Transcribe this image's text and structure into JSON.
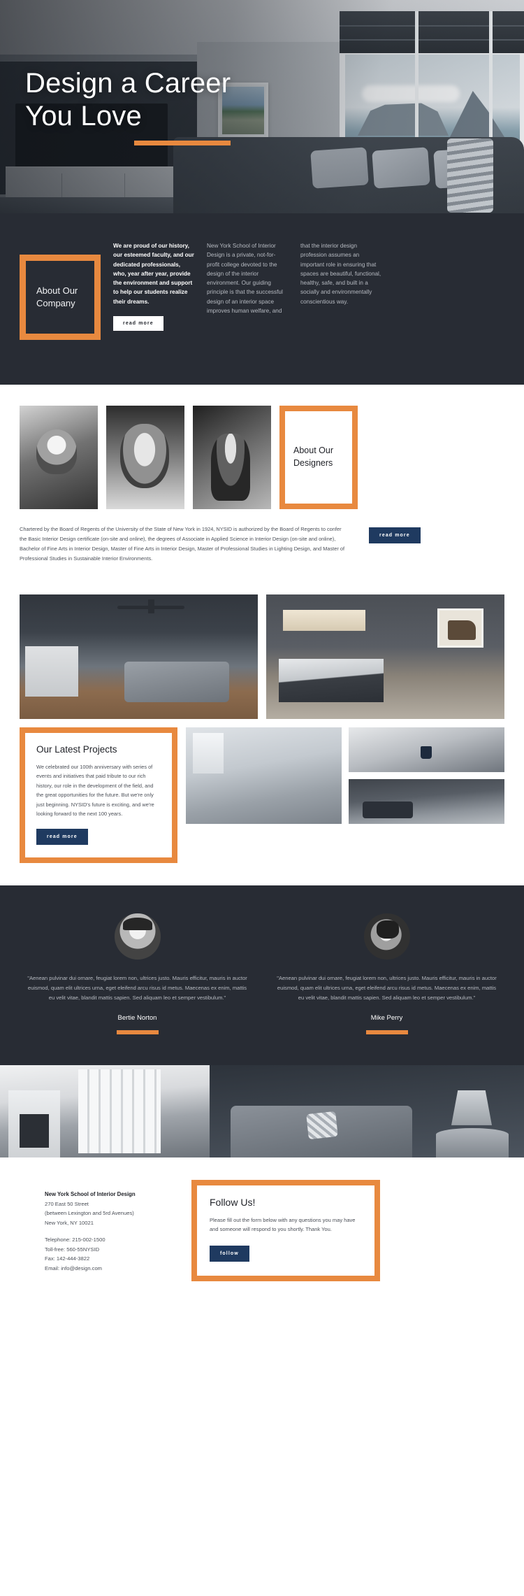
{
  "hero": {
    "title_line1": "Design a Career",
    "title_line2": "You Love"
  },
  "about": {
    "heading": "About Our Company",
    "lead": "We are proud of our history, our esteemed faculty, and our dedicated professionals, who, year after year, provide the environment and support to help our students realize their dreams.",
    "col2": "New York School of Interior Design is a private, not-for-profit college devoted to the design of the interior environment. Our guiding principle is that the successful design of an interior space improves human welfare, and",
    "col3": "that the interior design profession assumes an important role in ensuring that spaces are beautiful, functional, healthy, safe, and built in a socially and environmentally conscientious way.",
    "read_more": "read more"
  },
  "designers": {
    "heading": "About Our Designers",
    "chartered": "Chartered by the Board of Regents of the University of the State of New York in 1924, NYSID is authorized by the Board of Regents to confer the Basic Interior Design certificate (on-site and online), the degrees of Associate in Applied Science in Interior Design (on-site and online), Bachelor of Fine Arts in Interior Design, Master of Fine Arts in Interior Design, Master of Professional Studies in Lighting Design, and Master of Professional Studies in Sustainable Interior Environments.",
    "read_more": "read more",
    "photo_1_alt": "woman-smiling-photo",
    "photo_2_alt": "man-portrait-photo",
    "photo_3_alt": "woman-jacket-photo"
  },
  "projects": {
    "title": "Our Latest Projects",
    "text": "We celebrated our 100th anniversary with series of events and initiatives that paid tribute to our rich history, our role in the development of the field, and the great opportunities for the future. But we're only just beginning. NYSID's future is exciting, and we're looking forward to the next 100 years.",
    "read_more": "read more"
  },
  "testimonials": [
    {
      "quote": "\"Aenean pulvinar dui ornare, feugiat lorem non, ultrices justo. Mauris efficitur, mauris in auctor euismod, quam elit ultrices urna, eget eleifend arcu risus id metus. Maecenas ex enim, mattis eu velit vitae, blandit mattis sapien. Sed aliquam leo et semper vestibulum.\"",
      "name": "Bertie Norton"
    },
    {
      "quote": "\"Aenean pulvinar dui ornare, feugiat lorem non, ultrices justo. Mauris efficitur, mauris in auctor euismod, quam elit ultrices urna, eget eleifend arcu risus id metus. Maecenas ex enim, mattis eu velit vitae, blandit mattis sapien. Sed aliquam leo et semper vestibulum.\"",
      "name": "Mike Perry"
    }
  ],
  "footer": {
    "org": "New York School of Interior Design",
    "address_1": "270 East 50 Street",
    "address_2": "(between Lexington and 5rd Avenues)",
    "address_3": "New York, NY 10021",
    "telephone": "Telephone: 215-002-1500",
    "tollfree": "Toll-free: 560-55NYSID",
    "fax": "Fax: 142-444-3822",
    "email": "Email: info@design.com",
    "follow_title": "Follow Us!",
    "follow_text": "Please fill out the form below with any questions you may have and someone will respond to you shortly. Thank You.",
    "follow_button": "follow"
  },
  "colors": {
    "accent_orange": "#e8893f",
    "dark_bg": "#282c34",
    "navy_button": "#1f3a60"
  }
}
